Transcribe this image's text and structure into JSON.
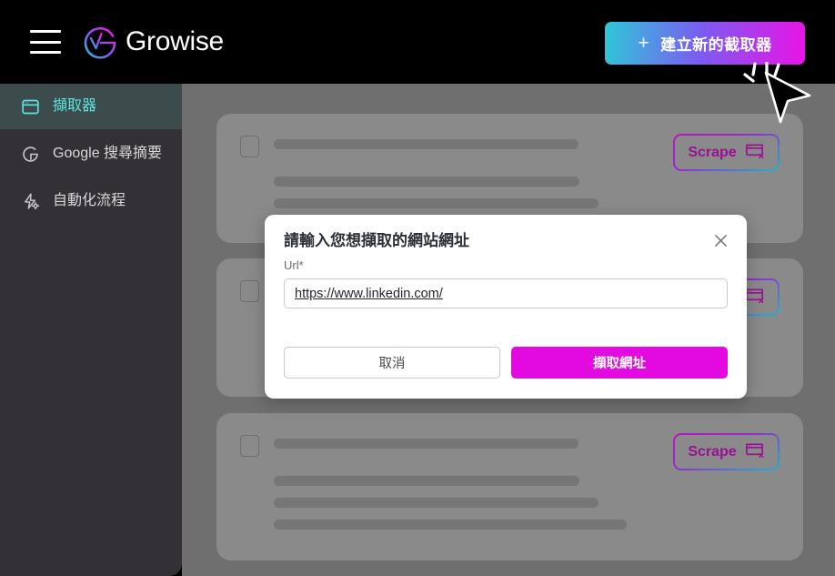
{
  "header": {
    "menu_icon": "hamburger-menu-icon",
    "brand_name": "Growise",
    "brand_logo_icon": "growise-logo-icon",
    "create_button_label": "建立新的截取器",
    "create_button_plus": "+",
    "gradient_start": "#2ec8d8",
    "gradient_mid": "#7b5cf0",
    "gradient_end": "#ea13e6",
    "background": "#000000"
  },
  "sidebar": {
    "background": "#333136",
    "active_background": "#3c4c4c",
    "active_color": "#5ee4e0",
    "items": [
      {
        "label": "擷取器",
        "icon": "browser-window-icon",
        "active": true
      },
      {
        "label": "Google 搜尋摘要",
        "icon": "google-g-icon",
        "active": false
      },
      {
        "label": "自動化流程",
        "icon": "automation-flow-icon",
        "active": false
      }
    ]
  },
  "main": {
    "overlay_background": "#6f6f6f",
    "card_background": "#8a8a8a",
    "skeleton_color": "#767676",
    "cards": [
      {
        "checkbox_checked": false,
        "scrape_label": "Scrape",
        "scrape_icon": "browser-window-x-icon",
        "skeleton_lines": [
          335,
          336,
          357
        ]
      },
      {
        "checkbox_checked": false,
        "scrape_label": "Scrape",
        "scrape_icon": "browser-window-x-icon",
        "skeleton_lines": [
          335,
          336,
          357
        ]
      },
      {
        "checkbox_checked": false,
        "scrape_label": "Scrape",
        "scrape_icon": "browser-window-x-icon",
        "skeleton_lines": [
          335,
          336,
          357,
          388
        ]
      }
    ]
  },
  "modal": {
    "title": "請輸入您想擷取的網站網址",
    "close_icon": "close-x-icon",
    "field_label": "Url*",
    "url_value": "https://www.linkedin.com/",
    "url_placeholder": "https://",
    "cancel_label": "取消",
    "submit_label": "擷取網址",
    "submit_color": "#e20ae0"
  },
  "cursor": {
    "icon": "mouse-pointer-click-icon"
  }
}
